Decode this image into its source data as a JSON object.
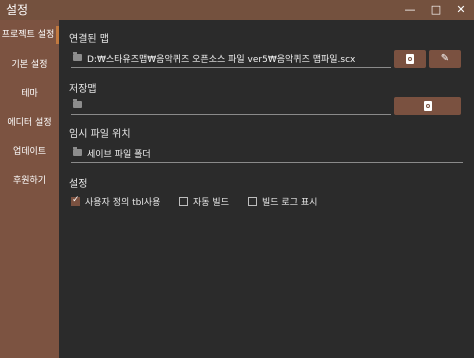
{
  "window": {
    "title": "설정",
    "minimize": "—",
    "maximize": "□",
    "close": "✕"
  },
  "sidebar": {
    "items": [
      {
        "label": "프로젝트 설정",
        "active": true
      },
      {
        "label": "기본 설정"
      },
      {
        "label": "테마"
      },
      {
        "label": "에디터 설정"
      },
      {
        "label": "업데이트"
      },
      {
        "label": "후원하기"
      }
    ]
  },
  "linked_map": {
    "label": "연결된 맵",
    "value": "D:₩스타유즈맵₩음악퀴즈 오픈소스 파일 ver5₩음악퀴즈 맵파일.scx"
  },
  "save_map": {
    "label": "저장맵",
    "value": ""
  },
  "temp_location": {
    "label": "임시 파일 위치",
    "value": "세이브 파일 폴더"
  },
  "settings": {
    "label": "설정",
    "options": [
      {
        "label": "사용자 정의 tbl사용",
        "checked": true
      },
      {
        "label": "자동 빌드",
        "checked": false
      },
      {
        "label": "빌드 로그 표시",
        "checked": false
      }
    ]
  }
}
